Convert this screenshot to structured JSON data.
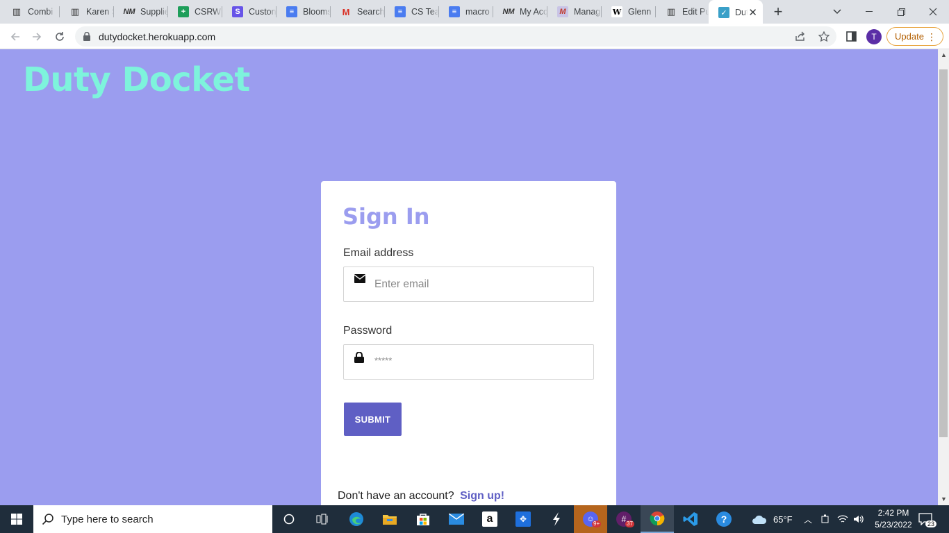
{
  "browser": {
    "tabs": [
      {
        "label": "Combi",
        "icon": "piano-icon"
      },
      {
        "label": "Karen S",
        "icon": "piano-icon"
      },
      {
        "label": "Supplie",
        "icon": "nm-icon"
      },
      {
        "label": "CSRW",
        "icon": "sheets-icon"
      },
      {
        "label": "Custon",
        "icon": "s-icon"
      },
      {
        "label": "Blooms",
        "icon": "docs-icon"
      },
      {
        "label": "Search",
        "icon": "gmail-icon"
      },
      {
        "label": "CS Tea",
        "icon": "docs-icon"
      },
      {
        "label": "macro",
        "icon": "docs-icon"
      },
      {
        "label": "My Acc",
        "icon": "nm-icon"
      },
      {
        "label": "Manag",
        "icon": "m-icon"
      },
      {
        "label": "Glenn",
        "icon": "wikipedia-icon"
      },
      {
        "label": "Edit Pu",
        "icon": "piano-icon"
      },
      {
        "label": "Dut",
        "icon": "duty-docket-icon",
        "active": true
      }
    ],
    "url": "dutydocket.herokuapp.com",
    "profile_initial": "T",
    "update_label": "Update"
  },
  "page": {
    "brand": "Duty Docket",
    "signin_title": "Sign In",
    "email_label": "Email address",
    "email_placeholder": "Enter email",
    "password_label": "Password",
    "password_placeholder": "*****",
    "submit_label": "SUBMIT",
    "signup_prompt": "Don't have an account?",
    "signup_link": "Sign up!",
    "colors": {
      "background": "#9b9def",
      "brand": "#7ef3dc",
      "title": "#9b9def",
      "button": "#5f5fc4"
    }
  },
  "taskbar": {
    "search_placeholder": "Type here to search",
    "weather": "65°F",
    "time": "2:42 PM",
    "date": "5/23/2022",
    "notification_count": "23",
    "badges": {
      "discord": "9+",
      "slack": "37"
    }
  }
}
